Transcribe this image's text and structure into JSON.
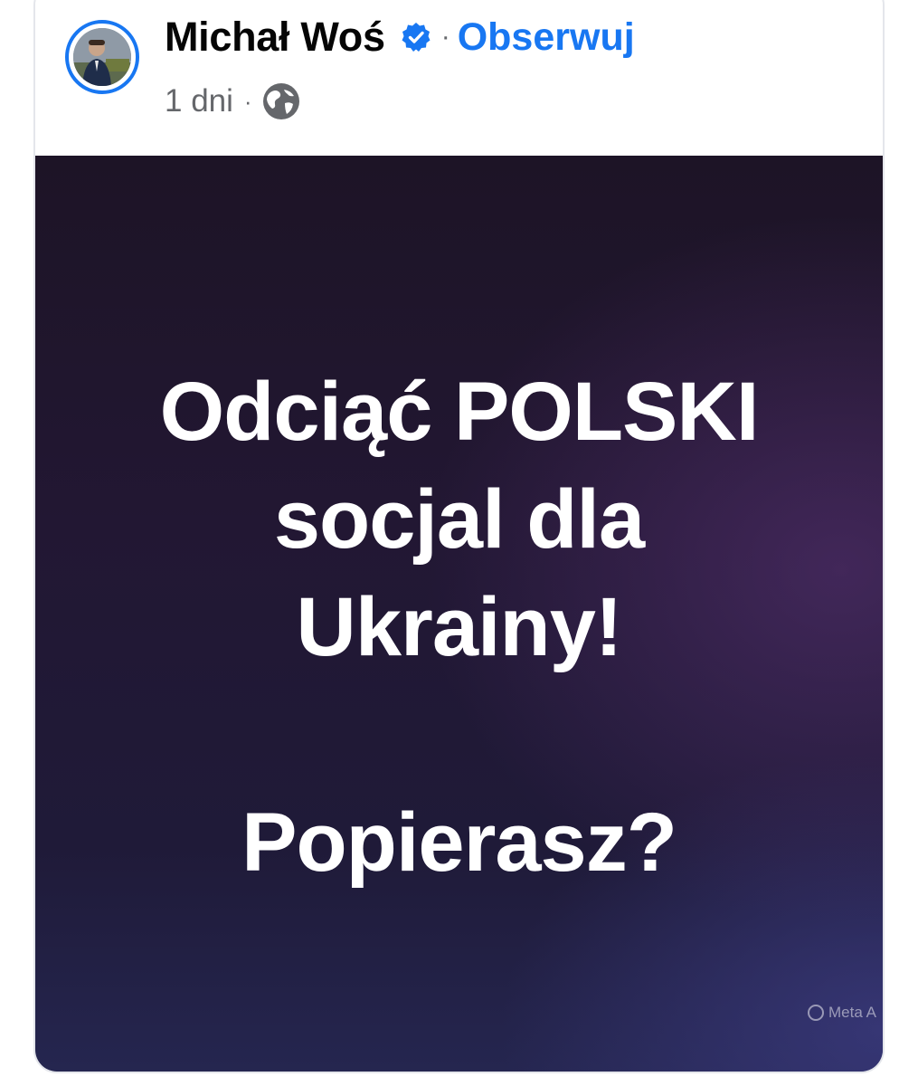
{
  "post": {
    "author_name": "Michał Woś",
    "separator": "·",
    "follow_label": "Obserwuj",
    "timestamp": "1 dni",
    "meta_separator": "·",
    "audience_icon": "globe-icon",
    "verified_icon": "verified-badge-icon",
    "image_text": {
      "line1": "Odciąć POLSKI",
      "line2": "socjal dla",
      "line3": "Ukrainy!",
      "line4": "Popierasz?"
    },
    "watermark": "Meta A"
  },
  "colors": {
    "link": "#1877f2",
    "name": "#050505",
    "secondary": "#65676b",
    "image_bg_top": "#1d1426",
    "image_bg_bottom": "#252650"
  }
}
